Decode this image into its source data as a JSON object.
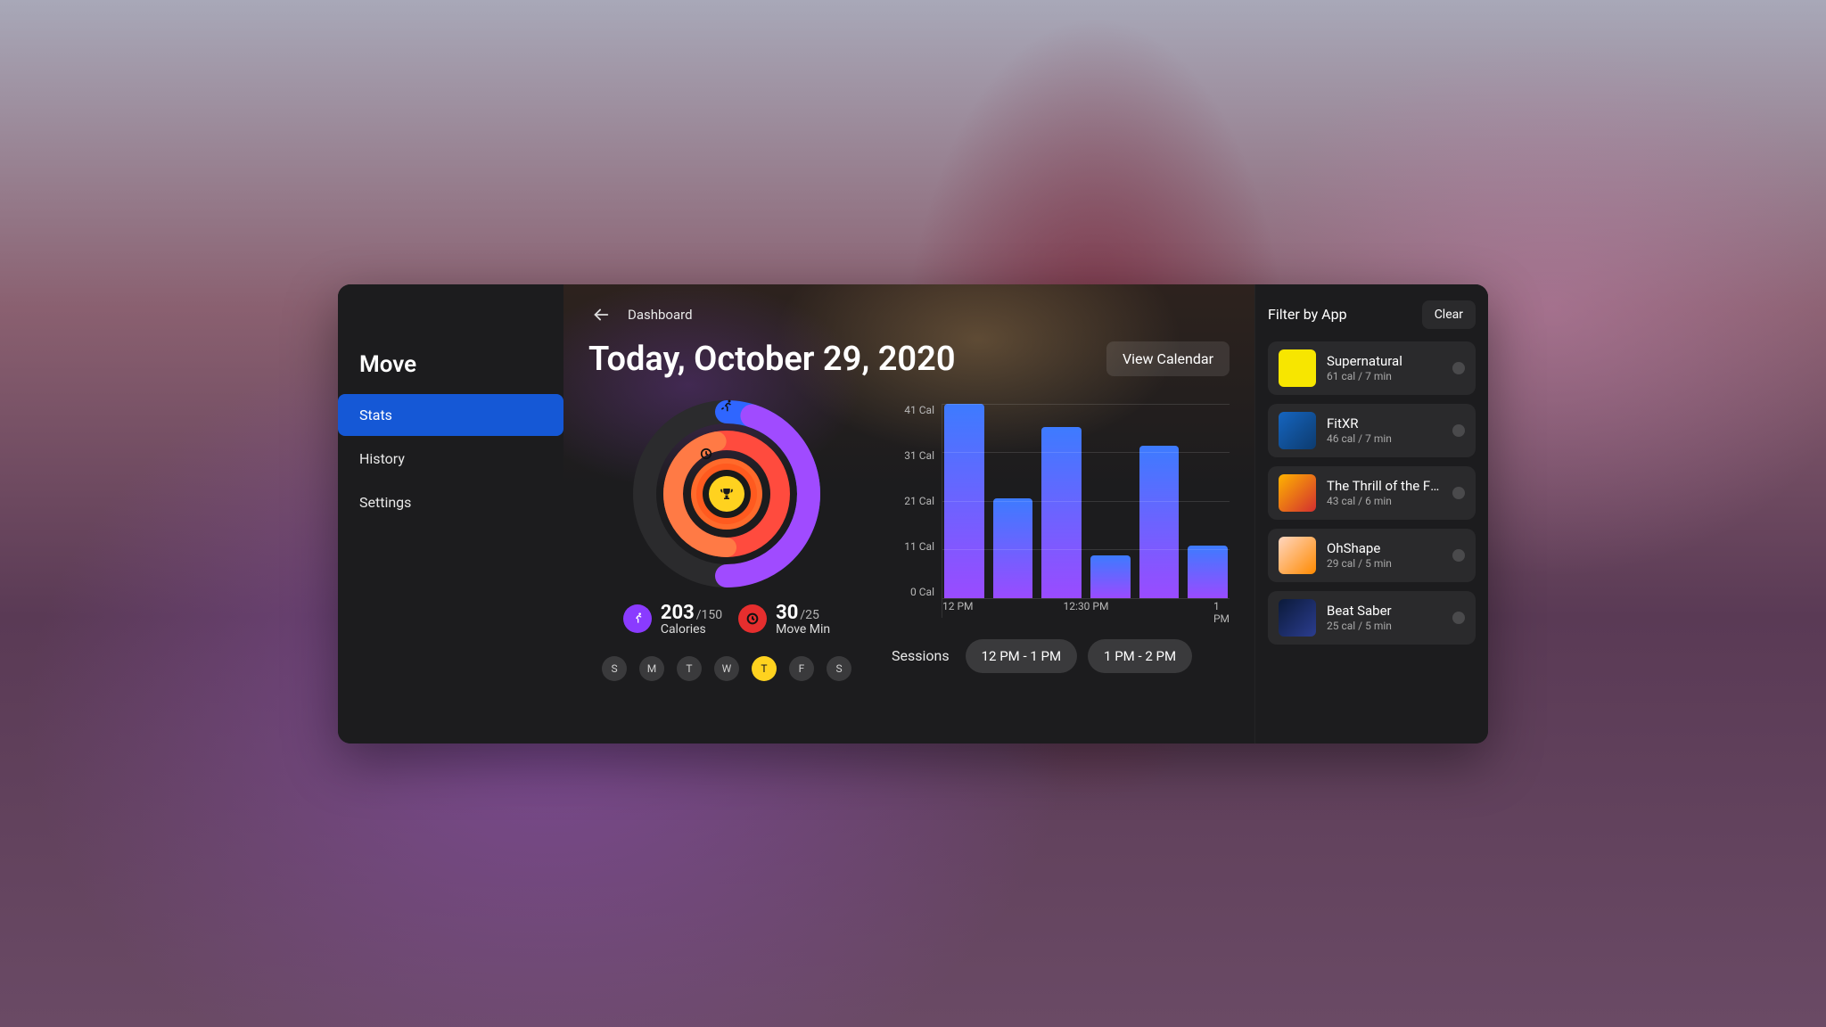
{
  "sidebar": {
    "title": "Move",
    "items": [
      {
        "label": "Stats",
        "active": true
      },
      {
        "label": "History",
        "active": false
      },
      {
        "label": "Settings",
        "active": false
      }
    ]
  },
  "header": {
    "breadcrumb": "Dashboard",
    "date_title": "Today, October 29, 2020",
    "view_calendar": "View Calendar"
  },
  "stats": {
    "calories": {
      "value": "203",
      "goal": "/150",
      "label": "Calories"
    },
    "move_min": {
      "value": "30",
      "goal": "/25",
      "label": "Move Min"
    }
  },
  "week": {
    "days": [
      "S",
      "M",
      "T",
      "W",
      "T",
      "F",
      "S"
    ],
    "today_index": 4
  },
  "chart_data": {
    "type": "bar",
    "y_ticks": [
      "41 Cal",
      "31 Cal",
      "21 Cal",
      "11 Cal",
      "0 Cal"
    ],
    "ylim": [
      0,
      41
    ],
    "x_ticks": [
      {
        "label": "12 PM",
        "pos": 0
      },
      {
        "label": "12:30 PM",
        "pos": 50
      },
      {
        "label": "1 PM",
        "pos": 100
      }
    ],
    "values": [
      41,
      21,
      36,
      9,
      32,
      11
    ]
  },
  "sessions": {
    "label": "Sessions",
    "pills": [
      "12 PM - 1 PM",
      "1 PM - 2 PM"
    ]
  },
  "filter": {
    "title": "Filter by App",
    "clear": "Clear",
    "apps": [
      {
        "name": "Supernatural",
        "sub": "61 cal / 7 min",
        "bg": "#f7e600",
        "fg": "#111"
      },
      {
        "name": "FitXR",
        "sub": "46 cal / 7 min",
        "bg": "linear-gradient(135deg,#1565c0,#0d3b6e)",
        "fg": "#fff"
      },
      {
        "name": "The Thrill of the Fi...",
        "sub": "43 cal / 6 min",
        "bg": "linear-gradient(135deg,#ffb300,#d32f2f)",
        "fg": "#fff"
      },
      {
        "name": "OhShape",
        "sub": "29 cal / 5 min",
        "bg": "linear-gradient(135deg,#ffd6c0,#ff8a00)",
        "fg": "#333"
      },
      {
        "name": "Beat Saber",
        "sub": "25 cal / 5 min",
        "bg": "linear-gradient(135deg,#0b1a3a,#2b3d8f)",
        "fg": "#ff5a8a"
      }
    ]
  },
  "icons": {
    "runner": "runner-icon",
    "clock": "clock-icon",
    "trophy": "trophy-icon",
    "back": "back-icon"
  }
}
